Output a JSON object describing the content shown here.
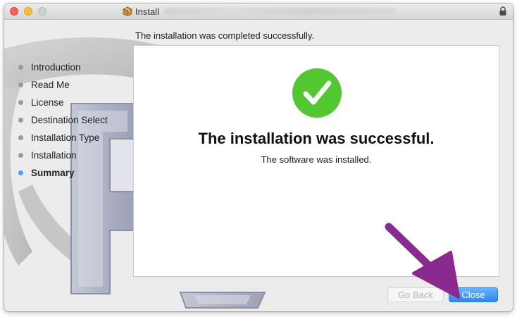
{
  "window": {
    "title": "Install",
    "controls": [
      "close",
      "minimize",
      "maximize"
    ],
    "title_icon": "package-icon",
    "lock_icon": "lock-icon"
  },
  "header": {
    "status_text": "The installation was completed successfully."
  },
  "sidebar": {
    "items": [
      {
        "label": "Introduction",
        "active": false
      },
      {
        "label": "Read Me",
        "active": false
      },
      {
        "label": "License",
        "active": false
      },
      {
        "label": "Destination Select",
        "active": false
      },
      {
        "label": "Installation Type",
        "active": false
      },
      {
        "label": "Installation",
        "active": false
      },
      {
        "label": "Summary",
        "active": true
      }
    ]
  },
  "main": {
    "icon": "checkmark-circle-icon",
    "title": "The installation was successful.",
    "subtitle": "The software was installed."
  },
  "buttons": {
    "go_back": {
      "label": "Go Back",
      "enabled": false
    },
    "close": {
      "label": "Close",
      "enabled": true
    }
  },
  "colors": {
    "check_green": "#52c72f",
    "active_dot": "#4a9ef2",
    "default_button": "#2a87f0",
    "annotation_arrow": "#8a2a91"
  }
}
